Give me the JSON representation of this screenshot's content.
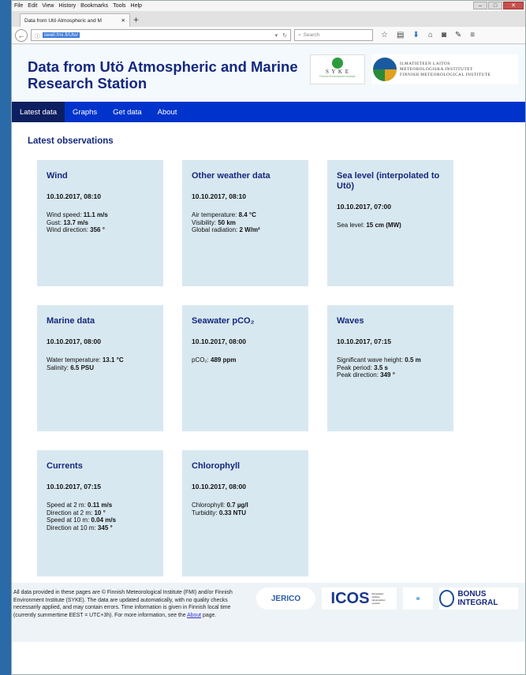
{
  "browser": {
    "menu": [
      "File",
      "Edit",
      "View",
      "History",
      "Bookmarks",
      "Tools",
      "Help"
    ],
    "tab_title": "Data from Utö Atmospheric and M",
    "url": "swell.fmi.fi/Uto/",
    "search_placeholder": "Search"
  },
  "header": {
    "title_line1": "Data from Utö Atmospheric and Marine",
    "title_line2": "Research Station",
    "syke_text": "S Y K E",
    "syke_sub": "Finnish Environment Institute",
    "fmi_line1": "ILMATIETEEN LAITOS",
    "fmi_line2": "METEOROLOGISKA INSTITUTET",
    "fmi_line3": "FINNISH METEOROLOGICAL INSTITUTE"
  },
  "nav": {
    "latest": "Latest data",
    "graphs": "Graphs",
    "get": "Get data",
    "about": "About"
  },
  "heading": "Latest observations",
  "cards": {
    "wind": {
      "title": "Wind",
      "date": "10.10.2017, 08:10",
      "l1": "Wind speed: ",
      "v1": "11.1 m/s",
      "l2": "Gust: ",
      "v2": "13.7 m/s",
      "l3": "Wind direction: ",
      "v3": "356 °"
    },
    "weather": {
      "title": "Other weather data",
      "date": "10.10.2017, 08:10",
      "l1": "Air temperature: ",
      "v1": "8.4 °C",
      "l2": "Visibility: ",
      "v2": "50 km",
      "l3": "Global radiation: ",
      "v3": "2 W/m²"
    },
    "sea": {
      "title": "Sea level (interpolated to Utö)",
      "date": "10.10.2017, 07:00",
      "l1": "Sea level: ",
      "v1": "15 cm (MW)"
    },
    "marine": {
      "title": "Marine data",
      "date": "10.10.2017, 08:00",
      "l1": "Water temperature: ",
      "v1": "13.1 °C",
      "l2": "Salinity: ",
      "v2": "6.5 PSU"
    },
    "pco2": {
      "title": "Seawater pCO₂",
      "date": "10.10.2017, 08:00",
      "l1": "pCO₂: ",
      "v1": "489 ppm"
    },
    "waves": {
      "title": "Waves",
      "date": "10.10.2017, 07:15",
      "l1": "Significant wave height: ",
      "v1": "0.5 m",
      "l2": "Peak period: ",
      "v2": "3.5 s",
      "l3": "Peak direction: ",
      "v3": "349 °"
    },
    "currents": {
      "title": "Currents",
      "date": "10.10.2017, 07:15",
      "l1": "Speed at 2 m: ",
      "v1": "0.11 m/s",
      "l2": "Direction at 2 m: ",
      "v2": "10 °",
      "l3": "Speed at 10 m: ",
      "v3": "0.04 m/s",
      "l4": "Direction at 10 m: ",
      "v4": "345 °"
    },
    "chloro": {
      "title": "Chlorophyll",
      "date": "10.10.2017, 08:00",
      "l1": "Chlorophyll: ",
      "v1": "0.7 µg/l",
      "l2": "Turbidity: ",
      "v2": "0.33 NTU"
    }
  },
  "footer": {
    "text": "All data provided in these pages are © Finnish Meteorological Institute (FMI) and/or Finnish Environment Institute (SYKE). The data are updated automatically, with no quality checks necessarily applied, and may contain errors. Time information is given in Finnish local time (currently summertime EEST = UTC+3h). For more information, see the ",
    "link": "About",
    "text_end": " page.",
    "logo_jerico": "JERICO",
    "logo_icos": "ICOS",
    "logo_icos_sub": "Integrated carbon observation system",
    "logo_bonus": "BONUS INTEGRAL"
  }
}
